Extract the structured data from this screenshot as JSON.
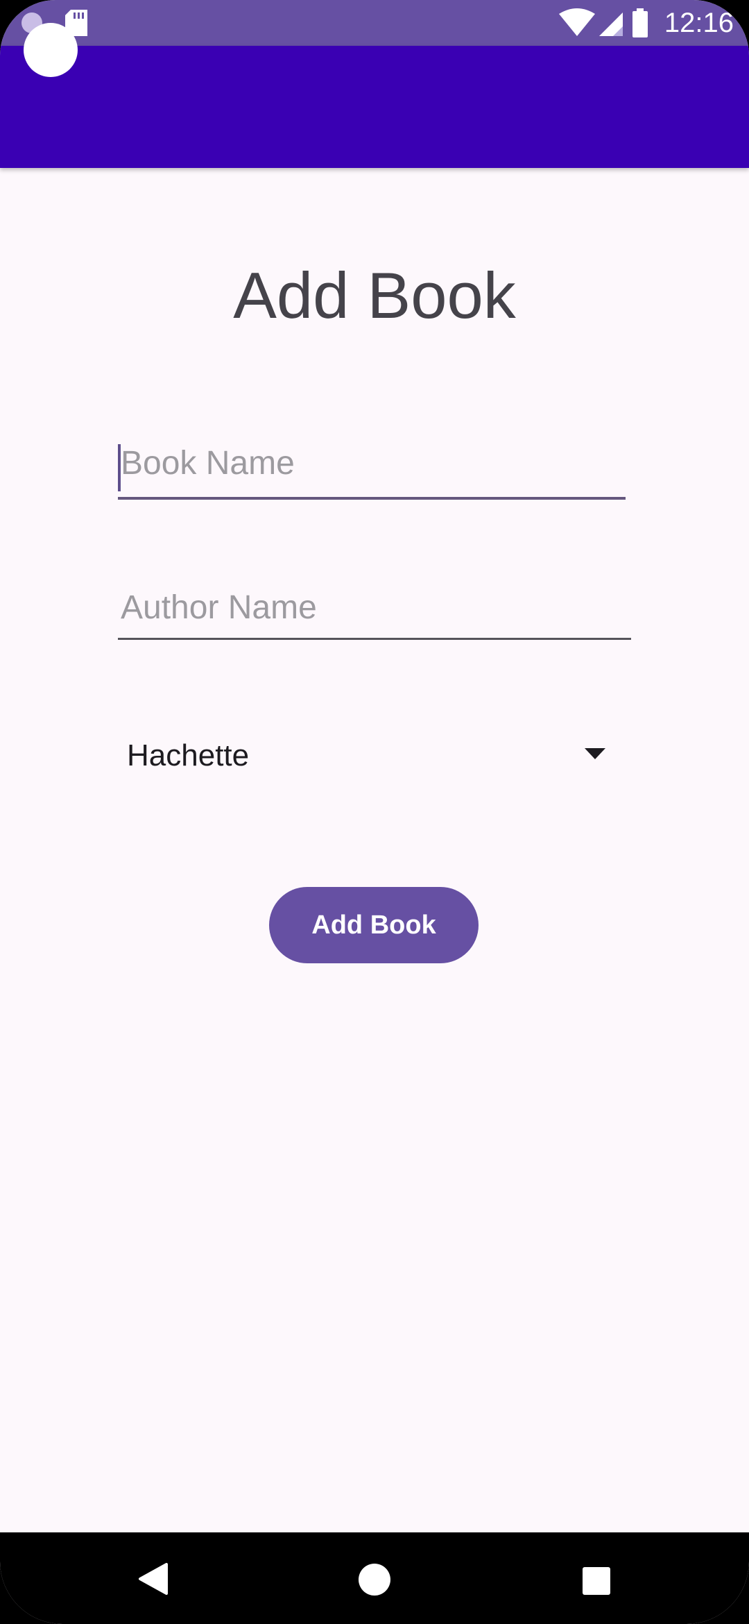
{
  "status_bar": {
    "time": "12:16",
    "icons": [
      "notification-circle-icon",
      "sd-card-icon",
      "wifi-icon",
      "cell-signal-icon",
      "battery-icon"
    ]
  },
  "screen": {
    "title": "Add Book"
  },
  "form": {
    "book_name_placeholder": "Book Name",
    "author_name_placeholder": "Author Name",
    "publisher_selected": "Hachette",
    "submit_label": "Add Book"
  },
  "nav_bar": {
    "icons": [
      "back-icon",
      "home-icon",
      "recents-icon"
    ]
  },
  "colors": {
    "status_bar": "#6650a3",
    "app_bar": "#3a00b3",
    "accent": "#6650a3",
    "background": "#fdf8fc"
  }
}
